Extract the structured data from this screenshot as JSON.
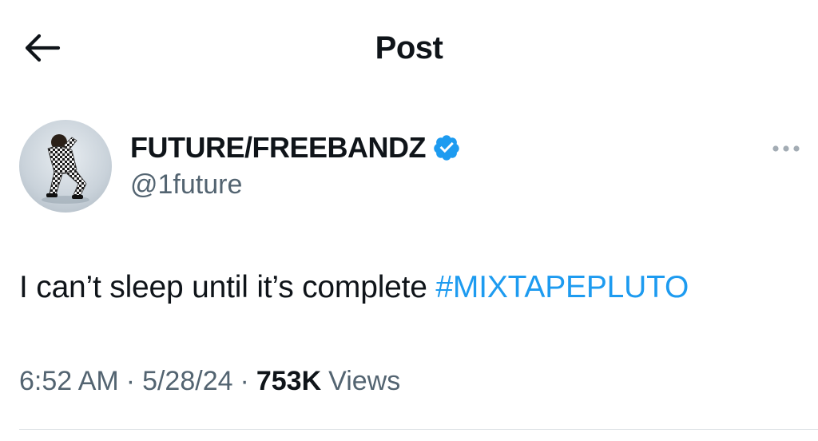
{
  "header": {
    "title": "Post",
    "back_icon": "arrow-left-icon"
  },
  "author": {
    "display_name": "FUTURE/FREEBANDZ",
    "handle": "@1future",
    "verified": true,
    "verified_color": "#1d9bf0",
    "avatar_icon": "user-avatar"
  },
  "post": {
    "text": "I can’t sleep until it’s complete",
    "hashtag": "#MIXTAPEPLUTO",
    "hashtag_color": "#1d9bf0"
  },
  "meta": {
    "time": "6:52 AM",
    "separator": "·",
    "date": "5/28/24",
    "views_count": "753K",
    "views_label": "Views"
  },
  "more_icon": "more-horizontal-icon"
}
